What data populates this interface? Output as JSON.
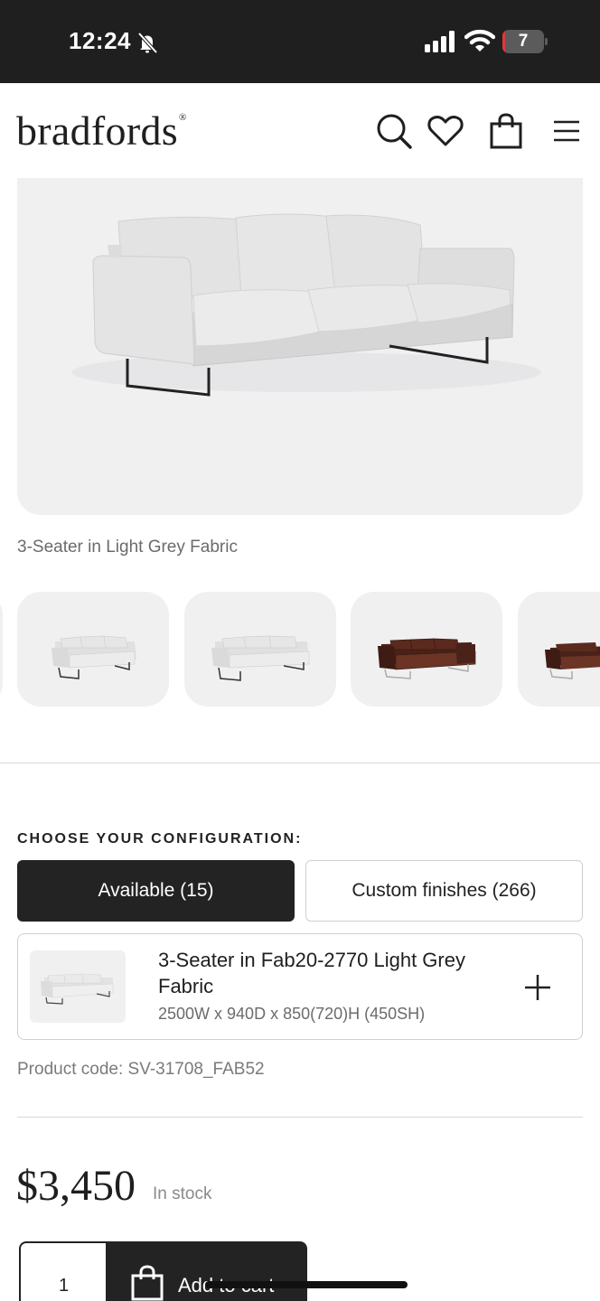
{
  "status_bar": {
    "time": "12:24",
    "battery_level": "7",
    "battery_fraction": 0.07,
    "icons": [
      "bell-off-icon",
      "signal-icon",
      "wifi-icon",
      "battery-icon"
    ]
  },
  "header": {
    "logo": "bradfords",
    "logo_mark": "®",
    "icons": [
      "search-icon",
      "heart-icon",
      "bag-icon",
      "menu-icon"
    ]
  },
  "gallery": {
    "caption": "3-Seater in Light Grey Fabric",
    "thumbnails": [
      {
        "color": "light-grey"
      },
      {
        "color": "light-grey"
      },
      {
        "color": "brown-leather"
      },
      {
        "color": "brown-leather"
      }
    ]
  },
  "configuration": {
    "heading": "CHOOSE YOUR CONFIGURATION:",
    "tabs": [
      {
        "label": "Available (15)",
        "active": true
      },
      {
        "label": "Custom finishes (266)",
        "active": false
      }
    ],
    "variant": {
      "title": "3-Seater in Fab20-2770 Light Grey Fabric",
      "dimensions": "2500W x 940D x 850(720)H (450SH)"
    },
    "product_code": "Product code: SV-31708_FAB52"
  },
  "purchase": {
    "price": "$3,450",
    "stock_status": "In stock",
    "quantity": "1",
    "add_to_cart_label": "Add to cart"
  },
  "colors": {
    "dark": "#232323",
    "status_bar": "#1f1f1f",
    "image_bg": "#f0f0f1",
    "muted_text": "#6b6b6b",
    "fabric_grey": "#e4e4e4",
    "leather_brown": "#5a2a1e",
    "battery_red": "#e0383b"
  }
}
